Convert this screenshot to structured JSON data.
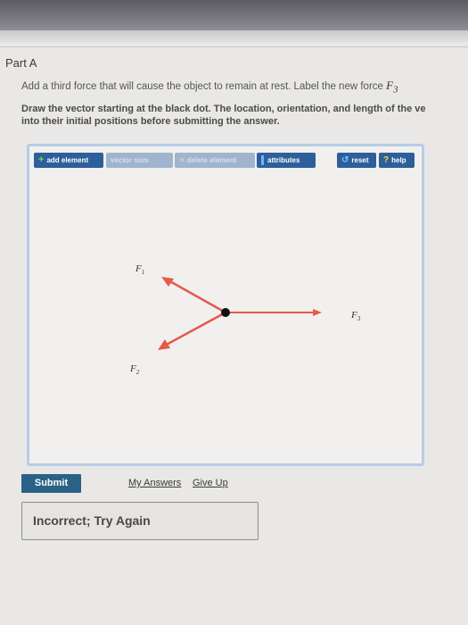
{
  "part": {
    "title": "Part A"
  },
  "instructions": {
    "line1_text": "Add a third force that will cause the object to remain at rest. Label the new force ",
    "line1_vector": "F",
    "line1_vector_sub": "3",
    "line2": "Draw the vector starting at the black dot. The location, orientation, and length of the ve",
    "line3": "into their initial positions before submitting the answer."
  },
  "toolbar": {
    "add_element": "add element",
    "vector_sum": "vector sum",
    "delete_element": "delete element",
    "attributes": "attributes",
    "reset": "reset",
    "help": "help"
  },
  "vectors": [
    {
      "label": "F",
      "sub": "1"
    },
    {
      "label": "F",
      "sub": "2"
    },
    {
      "label": "F",
      "sub": "3"
    }
  ],
  "colors": {
    "vector": "#e55a4a",
    "accent_blue": "#2d5f9a",
    "frame": "#b7cde8"
  },
  "actions": {
    "submit": "Submit",
    "my_answers": "My Answers",
    "give_up": "Give Up"
  },
  "feedback": {
    "text": "Incorrect; Try Again"
  }
}
